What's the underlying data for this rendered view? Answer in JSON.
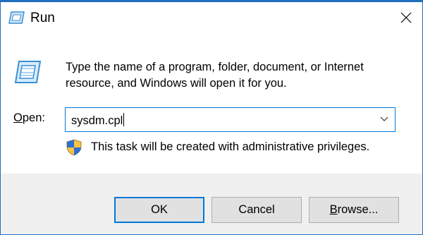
{
  "window": {
    "title": "Run"
  },
  "icons": {
    "title": "run-icon",
    "large": "run-icon",
    "close": "close-icon",
    "dropdown": "chevron-down-icon",
    "uac": "uac-shield-icon"
  },
  "description": "Type the name of a program, folder, document, or Internet resource, and Windows will open it for you.",
  "open": {
    "label_mnemonic": "O",
    "label_rest": "pen:",
    "value": "sysdm.cpl"
  },
  "admin_note": "This task will be created with administrative privileges.",
  "buttons": {
    "ok": "OK",
    "cancel": "Cancel",
    "browse_mnemonic": "B",
    "browse_rest": "rowse..."
  },
  "colors": {
    "accent": "#0078d7",
    "footer": "#f0f0f0",
    "button": "#e1e1e1"
  }
}
